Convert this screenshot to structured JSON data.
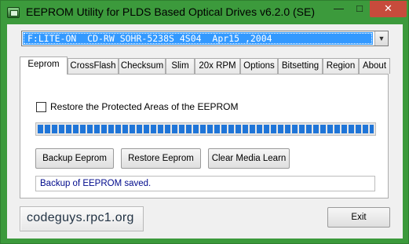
{
  "window": {
    "title": "EEPROM Utility for PLDS Based Optical Drives v6.2.0 (SE)",
    "controls": {
      "minimize": "—",
      "maximize": "□",
      "close": "✕"
    }
  },
  "drive_select": {
    "selected": "F:LITE-ON  CD-RW SOHR-5238S 4S04  Apr15 ,2004",
    "arrow": "▼"
  },
  "tabs": [
    {
      "label": "Eeprom",
      "active": true
    },
    {
      "label": "CrossFlash"
    },
    {
      "label": "Checksum"
    },
    {
      "label": "Slim"
    },
    {
      "label": "20x RPM"
    },
    {
      "label": "Options"
    },
    {
      "label": "Bitsetting"
    },
    {
      "label": "Region"
    },
    {
      "label": "About"
    }
  ],
  "eeprom_panel": {
    "restore_protected_label": "Restore the Protected Areas of the EEPROM",
    "restore_protected_checked": false,
    "progress_percent": 100,
    "buttons": {
      "backup": "Backup Eeprom",
      "restore": "Restore Eeprom",
      "clear": "Clear Media Learn"
    },
    "status": "Backup of EEPROM saved."
  },
  "footer": {
    "logo_text": "codeguys.rpc1.org",
    "exit": "Exit"
  },
  "colors": {
    "window_frame": "#3c9a3c",
    "selection": "#3399ff",
    "progress": "#1f75d8",
    "status_text": "#000a8c",
    "close_button": "#c74b3c"
  }
}
